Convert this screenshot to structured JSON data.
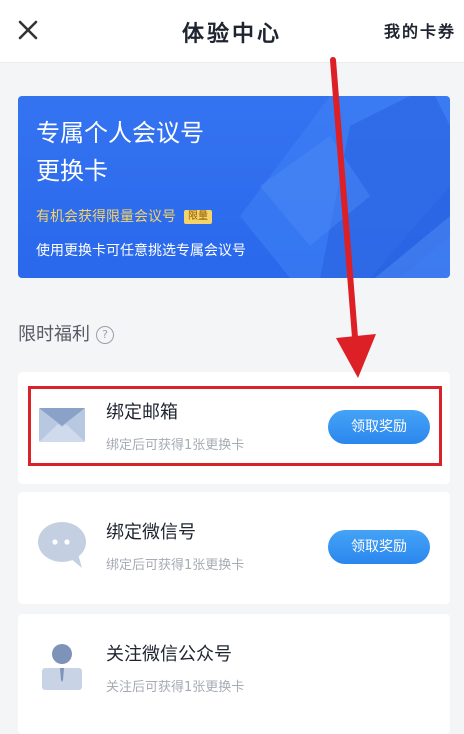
{
  "header": {
    "title": "体验中心",
    "right_link": "我的卡券"
  },
  "banner": {
    "title_line1": "专属个人会议号",
    "title_line2": "更换卡",
    "subtitle": "有机会获得限量会议号",
    "badge": "限量",
    "description": "使用更换卡可任意挑选专属会议号"
  },
  "section": {
    "title": "限时福利"
  },
  "tasks": [
    {
      "title": "绑定邮箱",
      "subtitle": "绑定后可获得1张更换卡",
      "button": "领取奖励",
      "icon": "envelope-icon"
    },
    {
      "title": "绑定微信号",
      "subtitle": "绑定后可获得1张更换卡",
      "button": "领取奖励",
      "icon": "chat-bubble-icon"
    },
    {
      "title": "关注微信公众号",
      "subtitle": "关注后可获得1张更换卡",
      "icon": "person-icon"
    }
  ],
  "colors": {
    "banner_blue": "#2f6fee",
    "button_blue": "#3a97f2",
    "highlight_red": "#d9232a"
  }
}
